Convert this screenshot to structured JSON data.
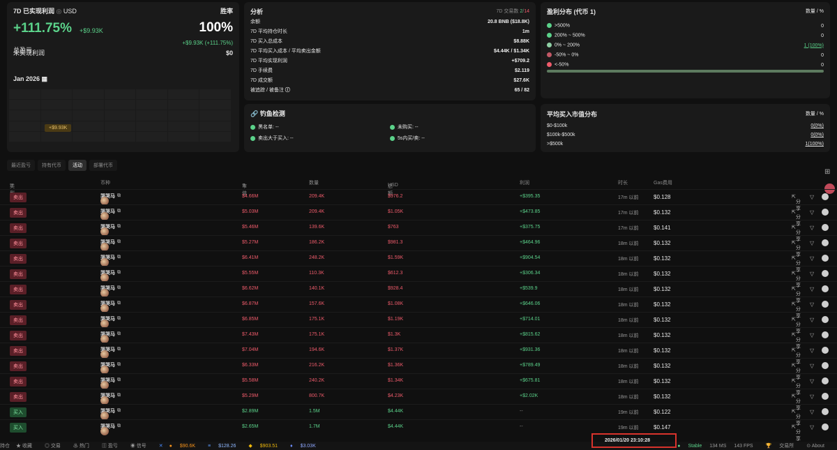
{
  "pnl": {
    "title": "7D 已实现利润",
    "currency": "USD",
    "winrate_label": "胜率",
    "pct": "+111.75%",
    "amount": "+$9.93K",
    "winrate": "100%",
    "winrate_sub": "+$9.93K (+111.75%)",
    "total_label": "总盈亏",
    "total_value": "",
    "unreal_label": "未实现利润",
    "unreal_value": "$0",
    "month": "Jan 2026",
    "cal_badge": "+$9.93K"
  },
  "analysis": {
    "title": "分析",
    "tx_label": "7D 交易数",
    "tx_buy": "2",
    "tx_sep": "/",
    "tx_sell": "14",
    "rows": [
      {
        "label": "余额",
        "value": "20.8 BNB ($18.8K)"
      },
      {
        "label": "7D 平均持仓时长",
        "value": "1m"
      },
      {
        "label": "7D 买入总成本",
        "value": "$8.88K"
      },
      {
        "label": "7D 平均买入成本 / 平均卖出金额",
        "value": "$4.44K / $1.34K"
      },
      {
        "label": "7D 平均实现利润",
        "value": "+$709.2"
      },
      {
        "label": "7D 手续费",
        "value": "$2.119"
      },
      {
        "label": "7D 成交额",
        "value": "$27.6K"
      },
      {
        "label": "被追踪 / 被备注",
        "value": "65 / 82"
      }
    ]
  },
  "fish": {
    "title": "钓鱼检测",
    "blacklist": "黑名单: --",
    "unbought": "未购买: --",
    "sell_more": "卖出大于买入: --",
    "quick": "5s内买/卖: --"
  },
  "profit": {
    "title": "盈利分布 (代币 1)",
    "col": "数量 / %",
    "rows": [
      {
        "label": ">500%",
        "value": "0",
        "color": "#5bd28a"
      },
      {
        "label": "200% ~ 500%",
        "value": "0",
        "color": "#5bd28a"
      },
      {
        "label": "0% ~ 200%",
        "value": "1 (100%)",
        "color": "#5bd28a"
      },
      {
        "label": "-50% ~ 0%",
        "value": "0",
        "color": "#c25866"
      },
      {
        "label": "<-50%",
        "value": "0",
        "color": "#ef5b6b"
      }
    ]
  },
  "avg": {
    "title": "平均买入市值分布",
    "col": "数量 / %",
    "rows": [
      {
        "label": "$0-$100k",
        "value": "0(0%)"
      },
      {
        "label": "$100k-$500k",
        "value": "0(0%)"
      },
      {
        "label": ">$500k",
        "value": "1(100%)"
      }
    ]
  },
  "tabs": [
    "最近盈亏",
    "持有代币",
    "活动",
    "部署代币"
  ],
  "headers": {
    "type": "类型",
    "token": "币种",
    "mc": "市值",
    "qty": "数量",
    "total": "总额",
    "total_unit": "USD",
    "profit": "利润",
    "time": "时长",
    "gas": "Gas费用"
  },
  "share_label": "分享",
  "rows": [
    {
      "type": "卖出",
      "side": "sell",
      "token": "哭哭马",
      "mc": "$4.66M",
      "qty": "209.4K",
      "total": "$976.2",
      "profit": "+$395.35",
      "time": "17m 以前",
      "gas": "$0.128"
    },
    {
      "type": "卖出",
      "side": "sell",
      "token": "哭哭马",
      "mc": "$5.03M",
      "qty": "209.4K",
      "total": "$1.05K",
      "profit": "+$473.85",
      "time": "17m 以前",
      "gas": "$0.132"
    },
    {
      "type": "卖出",
      "side": "sell",
      "token": "哭哭马",
      "mc": "$5.46M",
      "qty": "139.6K",
      "total": "$763",
      "profit": "+$375.75",
      "time": "17m 以前",
      "gas": "$0.141"
    },
    {
      "type": "卖出",
      "side": "sell",
      "token": "哭哭马",
      "mc": "$5.27M",
      "qty": "186.2K",
      "total": "$981.3",
      "profit": "+$464.96",
      "time": "18m 以前",
      "gas": "$0.132"
    },
    {
      "type": "卖出",
      "side": "sell",
      "token": "哭哭马",
      "mc": "$6.41M",
      "qty": "248.2K",
      "total": "$1.59K",
      "profit": "+$904.54",
      "time": "18m 以前",
      "gas": "$0.132"
    },
    {
      "type": "卖出",
      "side": "sell",
      "token": "哭哭马",
      "mc": "$5.55M",
      "qty": "110.3K",
      "total": "$612.3",
      "profit": "+$306.34",
      "time": "18m 以前",
      "gas": "$0.132"
    },
    {
      "type": "卖出",
      "side": "sell",
      "token": "哭哭马",
      "mc": "$6.62M",
      "qty": "140.1K",
      "total": "$928.4",
      "profit": "+$539.9",
      "time": "18m 以前",
      "gas": "$0.132"
    },
    {
      "type": "卖出",
      "side": "sell",
      "token": "哭哭马",
      "mc": "$6.87M",
      "qty": "157.6K",
      "total": "$1.08K",
      "profit": "+$646.06",
      "time": "18m 以前",
      "gas": "$0.132"
    },
    {
      "type": "卖出",
      "side": "sell",
      "token": "哭哭马",
      "mc": "$6.85M",
      "qty": "175.1K",
      "total": "$1.19K",
      "profit": "+$714.01",
      "time": "18m 以前",
      "gas": "$0.132"
    },
    {
      "type": "卖出",
      "side": "sell",
      "token": "哭哭马",
      "mc": "$7.43M",
      "qty": "175.1K",
      "total": "$1.3K",
      "profit": "+$815.62",
      "time": "18m 以前",
      "gas": "$0.132"
    },
    {
      "type": "卖出",
      "side": "sell",
      "token": "哭哭马",
      "mc": "$7.04M",
      "qty": "194.6K",
      "total": "$1.37K",
      "profit": "+$931.36",
      "time": "18m 以前",
      "gas": "$0.132"
    },
    {
      "type": "卖出",
      "side": "sell",
      "token": "哭哭马",
      "mc": "$6.33M",
      "qty": "216.2K",
      "total": "$1.36K",
      "profit": "+$789.49",
      "time": "18m 以前",
      "gas": "$0.132"
    },
    {
      "type": "卖出",
      "side": "sell",
      "token": "哭哭马",
      "mc": "$5.58M",
      "qty": "240.2K",
      "total": "$1.34K",
      "profit": "+$675.81",
      "time": "18m 以前",
      "gas": "$0.132"
    },
    {
      "type": "卖出",
      "side": "sell",
      "token": "哭哭马",
      "mc": "$5.29M",
      "qty": "800.7K",
      "total": "$4.23K",
      "profit": "+$2.02K",
      "time": "18m 以前",
      "gas": "$0.132"
    },
    {
      "type": "买入",
      "side": "buy",
      "token": "哭哭马",
      "mc": "$2.89M",
      "qty": "1.5M",
      "total": "$4.44K",
      "profit": "--",
      "time": "19m 以前",
      "gas": "$0.122"
    },
    {
      "type": "买入",
      "side": "buy",
      "token": "哭哭马",
      "mc": "$2.65M",
      "qty": "1.7M",
      "total": "$4.44K",
      "profit": "--",
      "time": "19m 以前",
      "gas": "$0.147"
    }
  ],
  "footer": {
    "hold": "持仓",
    "fav": "收藏",
    "trade": "交易",
    "hot": "热门",
    "pnl": "盈亏",
    "signal": "信号",
    "btc": "$90.6K",
    "eth": "$128.26",
    "bnb": "$903.51",
    "base": "$3.03K",
    "stable": "Stable",
    "ms": "134 MS",
    "fps": "143 FPS",
    "exchange": "交易所",
    "about": "About"
  },
  "clock": "2026/01/20 23:10:28"
}
